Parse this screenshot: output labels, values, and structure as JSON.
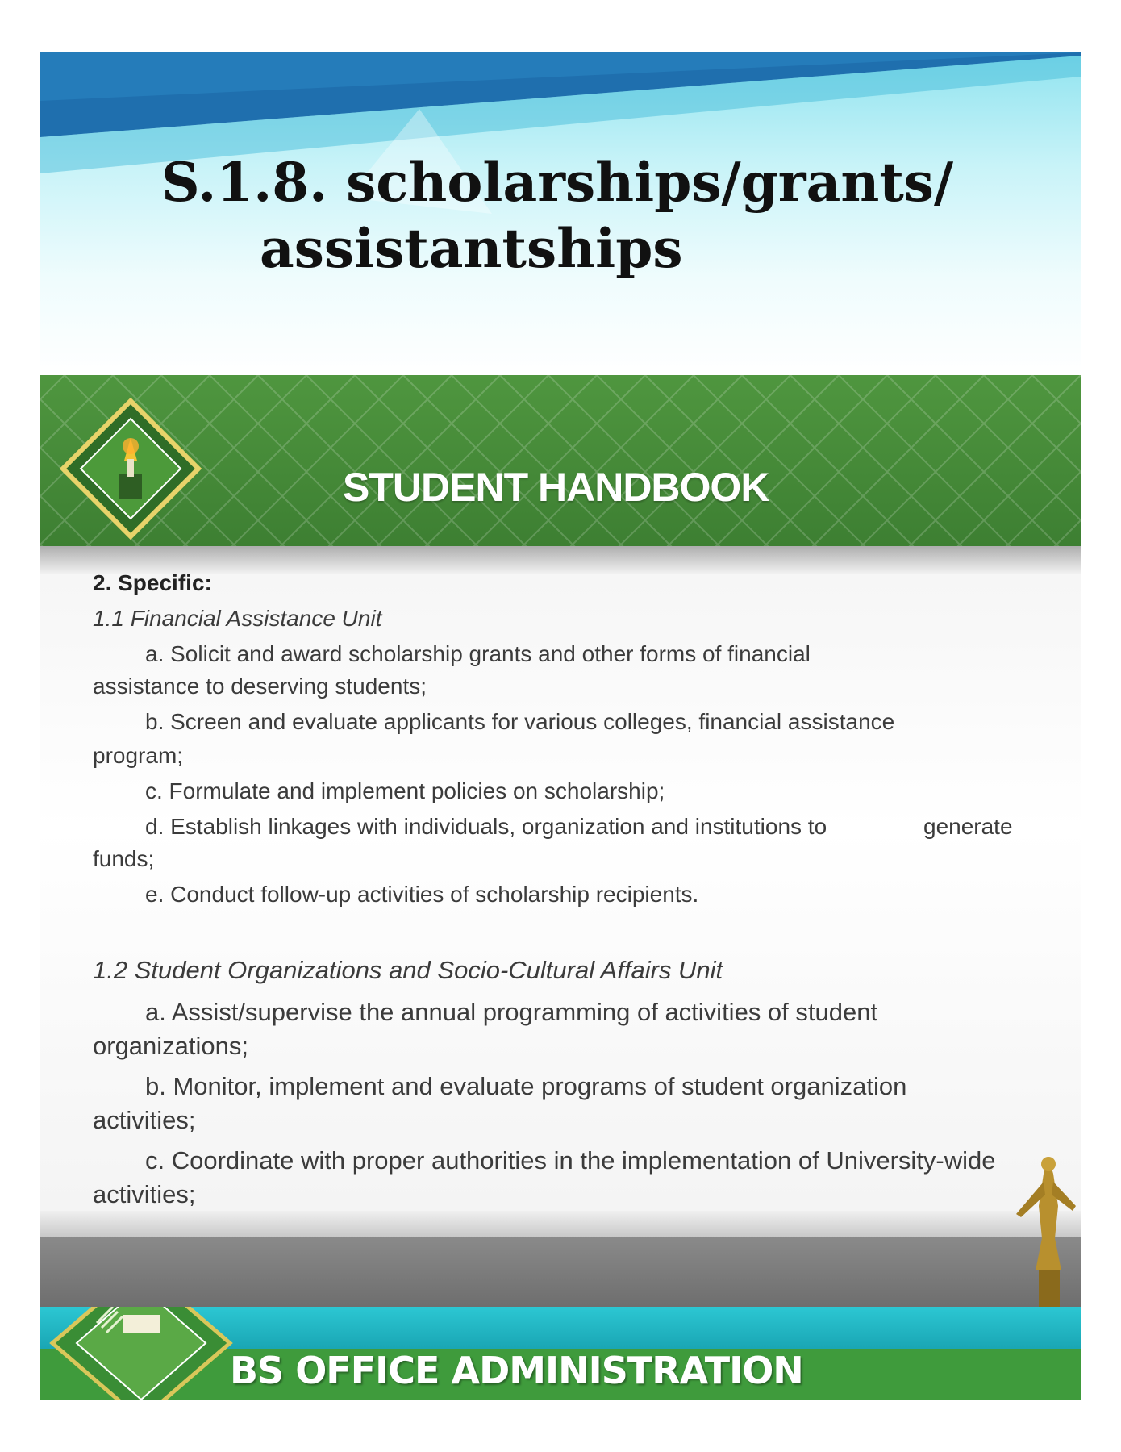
{
  "slide_title": {
    "line1": "S.1.8. scholarships/grants/",
    "line2": "assistantships"
  },
  "handbook": {
    "header_title": "STUDENT HANDBOOK",
    "section_heading": "2.   Specific:",
    "unit1": {
      "heading": "1.1    Financial Assistance Unit",
      "items": [
        {
          "first": "a.   Solicit and award scholarship grants and other forms of financial",
          "cont": "assistance to deserving students;"
        },
        {
          "first": "b.   Screen and evaluate applicants for various colleges, financial assistance",
          "cont": "program;"
        },
        {
          "first": "c.   Formulate and implement policies on scholarship;",
          "cont": ""
        },
        {
          "first": "d.   Establish linkages with individuals, organization and institutions to",
          "tail": "generate",
          "cont": "funds;"
        },
        {
          "first": "e.     Conduct follow-up activities of scholarship recipients.",
          "cont": ""
        }
      ]
    },
    "unit2": {
      "heading": "1.2    Student Organizations and Socio-Cultural Affairs Unit",
      "items": [
        {
          "first": "a.   Assist/supervise the annual programming of activities of student",
          "cont": "organizations;"
        },
        {
          "first": "b.  Monitor, implement and evaluate programs of student organization",
          "cont": "activities;"
        },
        {
          "first": "c.  Coordinate with proper authorities in the implementation of University-wide",
          "cont": "activities;"
        }
      ]
    }
  },
  "footer_banner": {
    "title": "BS OFFICE ADMINISTRATION"
  },
  "colors": {
    "header_green": "#3d7f32",
    "banner_teal": "#1aa6b4",
    "banner_green": "#3f9b3c",
    "title_sky": "#8fe3ef"
  }
}
